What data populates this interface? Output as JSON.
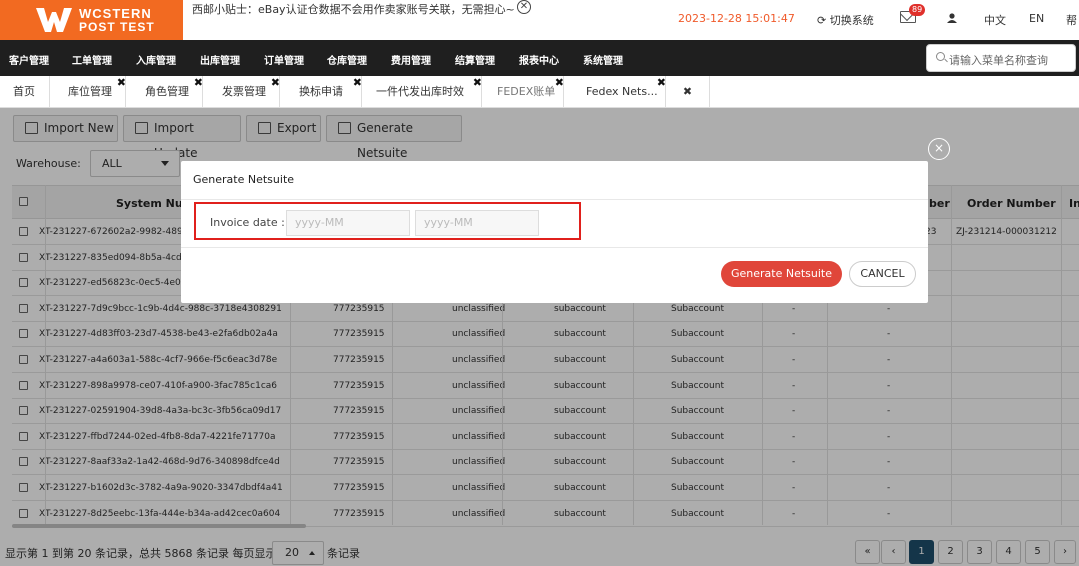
{
  "header": {
    "logo_line1": "WCSTERN",
    "logo_line2": "POST TEST",
    "tip": "西邮小贴士：eBay认证仓数据不会用作卖家账号关联，无需担心~",
    "datetime": "2023-12-28 15:01:47",
    "switch_system": "切换系统",
    "mail_badge": "89",
    "lang_zh": "中文",
    "lang_en": "EN",
    "help": "帮"
  },
  "nav": {
    "items": [
      "客户管理",
      "工单管理",
      "入库管理",
      "出库管理",
      "订单管理",
      "仓库管理",
      "费用管理",
      "结算管理",
      "报表中心",
      "系统管理"
    ],
    "search_placeholder": "请输入菜单名称查询"
  },
  "tabs": [
    {
      "label": "首页",
      "closable": false
    },
    {
      "label": "库位管理",
      "closable": true
    },
    {
      "label": "角色管理",
      "closable": true
    },
    {
      "label": "发票管理",
      "closable": true
    },
    {
      "label": "换标申请",
      "closable": true
    },
    {
      "label": "一件代发出库时效",
      "closable": true
    },
    {
      "label": "FEDEX账单",
      "closable": true
    },
    {
      "label": "Fedex Nets...",
      "closable": true
    },
    {
      "label": "",
      "closable": true
    }
  ],
  "toolbar": {
    "import_new": "Import New",
    "import_update": "Import Update",
    "export": "Export",
    "generate_netsuite": "Generate Netsuite"
  },
  "filters": {
    "warehouse_label": "Warehouse:",
    "warehouse_value": "ALL"
  },
  "table": {
    "headers": {
      "system_number": "System Num",
      "number": "ber",
      "order_number": "Order Number",
      "last": "In"
    },
    "rows": [
      {
        "sys": "XT-231227-672602a2-9982-489",
        "extra": "23",
        "order": "ZJ-231214-000031212"
      },
      {
        "sys": "XT-231227-835ed094-8b5a-4cd"
      },
      {
        "sys": "XT-231227-ed56823c-0ec5-4e0"
      },
      {
        "sys": "XT-231227-7d9c9bcc-1c9b-4d4c-988c-3718e4308291",
        "num": "777235915",
        "type": "unclassified",
        "acct": "subaccount",
        "acct2": "Subaccount",
        "d1": "-",
        "d2": "-"
      },
      {
        "sys": "XT-231227-4d83ff03-23d7-4538-be43-e2fa6db02a4a",
        "num": "777235915",
        "type": "unclassified",
        "acct": "subaccount",
        "acct2": "Subaccount",
        "d1": "-",
        "d2": "-"
      },
      {
        "sys": "XT-231227-a4a603a1-588c-4cf7-966e-f5c6eac3d78e",
        "num": "777235915",
        "type": "unclassified",
        "acct": "subaccount",
        "acct2": "Subaccount",
        "d1": "-",
        "d2": "-"
      },
      {
        "sys": "XT-231227-898a9978-ce07-410f-a900-3fac785c1ca6",
        "num": "777235915",
        "type": "unclassified",
        "acct": "subaccount",
        "acct2": "Subaccount",
        "d1": "-",
        "d2": "-"
      },
      {
        "sys": "XT-231227-02591904-39d8-4a3a-bc3c-3fb56ca09d17",
        "num": "777235915",
        "type": "unclassified",
        "acct": "subaccount",
        "acct2": "Subaccount",
        "d1": "-",
        "d2": "-"
      },
      {
        "sys": "XT-231227-ffbd7244-02ed-4fb8-8da7-4221fe71770a",
        "num": "777235915",
        "type": "unclassified",
        "acct": "subaccount",
        "acct2": "Subaccount",
        "d1": "-",
        "d2": "-"
      },
      {
        "sys": "XT-231227-8aaf33a2-1a42-468d-9d76-340898dfce4d",
        "num": "777235915",
        "type": "unclassified",
        "acct": "subaccount",
        "acct2": "Subaccount",
        "d1": "-",
        "d2": "-"
      },
      {
        "sys": "XT-231227-b1602d3c-3782-4a9a-9020-3347dbdf4a41",
        "num": "777235915",
        "type": "unclassified",
        "acct": "subaccount",
        "acct2": "Subaccount",
        "d1": "-",
        "d2": "-"
      },
      {
        "sys": "XT-231227-8d25eebc-13fa-444e-b34a-ad42cec0a604",
        "num": "777235915",
        "type": "unclassified",
        "acct": "subaccount",
        "acct2": "Subaccount",
        "d1": "-",
        "d2": "-"
      }
    ]
  },
  "pager": {
    "summary": "显示第 1 到第 20 条记录，总共 5868 条记录 每页显示",
    "page_size": "20",
    "unit": "条记录",
    "first": "«",
    "prev": "‹",
    "pages": [
      "1",
      "2",
      "3",
      "4",
      "5"
    ],
    "next": "›"
  },
  "modal": {
    "title": "Generate Netsuite",
    "invoice_label": "Invoice date :",
    "start_placeholder": "yyyy-MM",
    "end_placeholder": "yyyy-MM",
    "generate_label": "Generate Netsuite",
    "cancel_label": "CANCEL",
    "close_icon": "×"
  },
  "colors": {
    "brand": "#f26a21",
    "nav_bg": "#1f1f1f",
    "primary_button": "#e0463a",
    "highlight_box": "#e0201c",
    "pager_active": "#1e4e6c"
  }
}
